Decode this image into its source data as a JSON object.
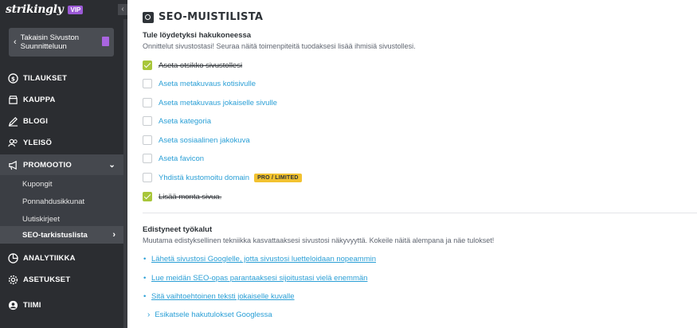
{
  "sidebar": {
    "logo": "strikingly",
    "vip": "VIP",
    "back_label": "Takaisin Sivuston Suunnitteluun",
    "nav": [
      {
        "label": "TILAUKSET",
        "icon": "dollar-icon"
      },
      {
        "label": "KAUPPA",
        "icon": "store-icon"
      },
      {
        "label": "BLOGI",
        "icon": "pen-icon"
      },
      {
        "label": "YLEISÖ",
        "icon": "users-icon"
      },
      {
        "label": "PROMOOTIO",
        "icon": "megaphone-icon"
      },
      {
        "label": "ANALYTIIKKA",
        "icon": "chart-icon"
      },
      {
        "label": "ASETUKSET",
        "icon": "gear-icon"
      },
      {
        "label": "TIIMI",
        "icon": "team-icon"
      }
    ],
    "sub": [
      {
        "label": "Kupongit"
      },
      {
        "label": "Ponnahdusikkunat"
      },
      {
        "label": "Uutiskirjeet"
      },
      {
        "label": "SEO-tarkistuslista"
      }
    ]
  },
  "main": {
    "title": "SEO-MUISTILISTA",
    "section1": {
      "heading": "Tule löydetyksi hakukoneessa",
      "desc": "Onnittelut sivustostasi! Seuraa näitä toimenpiteitä tuodaksesi lisää ihmisiä sivustollesi."
    },
    "checklist": [
      {
        "label": "Aseta otsikko sivustollesi",
        "done": true
      },
      {
        "label": "Aseta metakuvaus kotisivulle",
        "done": false
      },
      {
        "label": "Aseta metakuvaus jokaiselle sivulle",
        "done": false
      },
      {
        "label": "Aseta kategoria",
        "done": false
      },
      {
        "label": "Aseta sosiaalinen jakokuva",
        "done": false
      },
      {
        "label": "Aseta favicon",
        "done": false
      },
      {
        "label": "Yhdistä kustomoitu domain",
        "done": false,
        "badge": "PRO / LIMITED"
      },
      {
        "label": "Lisää monta sivua.",
        "done": true
      }
    ],
    "section2": {
      "heading": "Edistyneet työkalut",
      "desc": "Muutama edistyksellinen tekniikka kasvattaaksesi sivustosi näkyvyyttä. Kokeile näitä alempana ja näe tulokset!"
    },
    "tools": [
      "Lähetä sivustosi Googlelle, jotta sivustosi luetteloidaan nopeammin",
      "Lue meidän SEO-opas parantaaksesi sijoitustasi vielä enemmän",
      "Sitä vaihtoehtoinen teksti jokaiselle kuvalle"
    ],
    "preview": "Esikatsele hakutulokset Googlessa"
  },
  "colors": {
    "sidebar_bg": "#2b2d31",
    "link": "#2a9fd6",
    "check_done": "#a8c63a",
    "badge": "#f2c230",
    "vip": "#9b59d6"
  }
}
